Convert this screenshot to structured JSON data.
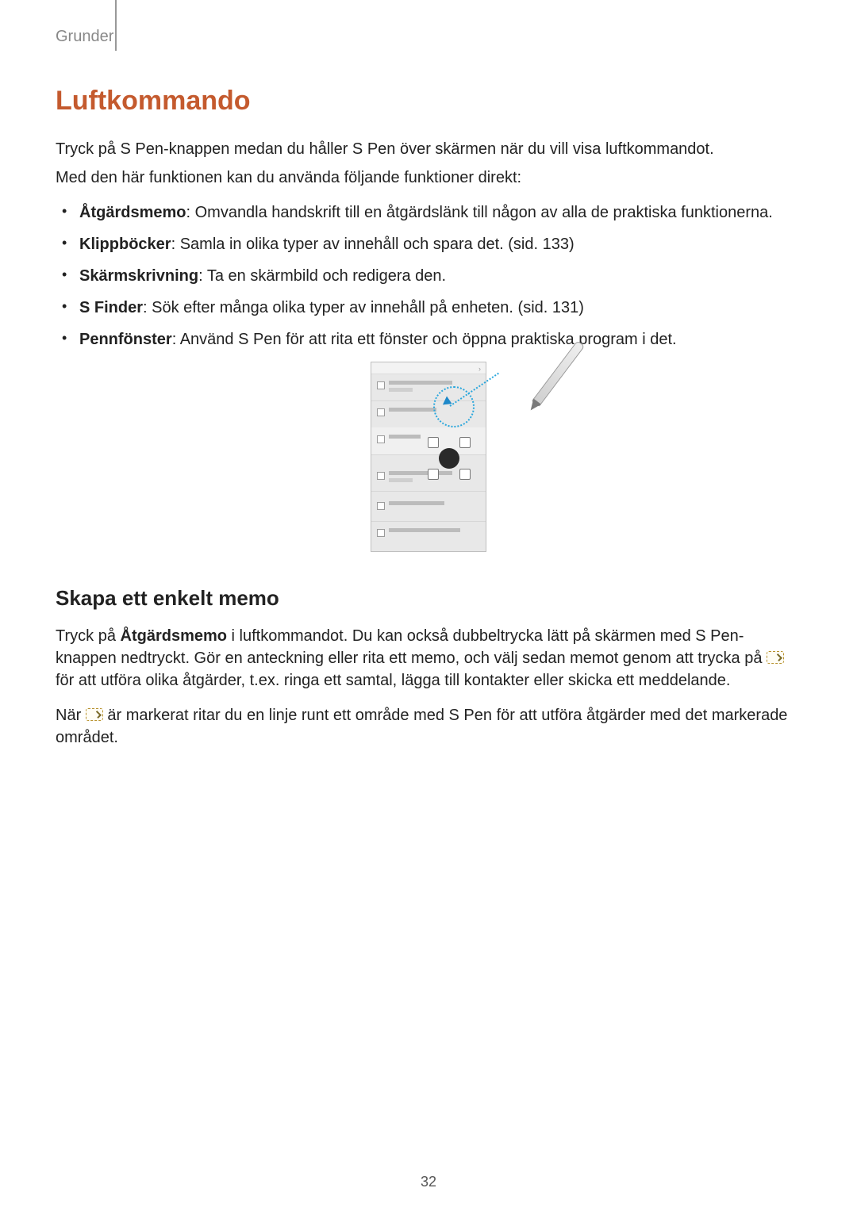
{
  "header": {
    "section": "Grunder"
  },
  "page_number": "32",
  "title": "Luftkommando",
  "intro": {
    "p1": "Tryck på S Pen-knappen medan du håller S Pen över skärmen när du vill visa luftkommandot.",
    "p2": "Med den här funktionen kan du använda följande funktioner direkt:"
  },
  "bullets": [
    {
      "term": "Åtgärdsmemo",
      "desc": ": Omvandla handskrift till en åtgärdslänk till någon av alla de praktiska funktionerna."
    },
    {
      "term": "Klippböcker",
      "desc": ": Samla in olika typer av innehåll och spara det. (sid. 133)"
    },
    {
      "term": "Skärmskrivning",
      "desc": ": Ta en skärmbild och redigera den."
    },
    {
      "term": "S Finder",
      "desc": ": Sök efter många olika typer av innehåll på enheten. (sid. 131)"
    },
    {
      "term": "Pennfönster",
      "desc": ": Använd S Pen för att rita ett fönster och öppna praktiska program i det."
    }
  ],
  "subsection": {
    "heading": "Skapa ett enkelt memo",
    "p1_a": "Tryck på ",
    "p1_bold": "Åtgärdsmemo",
    "p1_b": " i luftkommandot. Du kan också dubbeltrycka lätt på skärmen med S Pen-knappen nedtryckt. Gör en anteckning eller rita ett memo, och välj sedan memot genom att trycka på ",
    "p1_c": " för att utföra olika åtgärder, t.ex. ringa ett samtal, lägga till kontakter eller skicka ett meddelande.",
    "p2_a": "När ",
    "p2_b": " är markerat ritar du en linje runt ett område med S Pen för att utföra åtgärder med det markerade området."
  }
}
